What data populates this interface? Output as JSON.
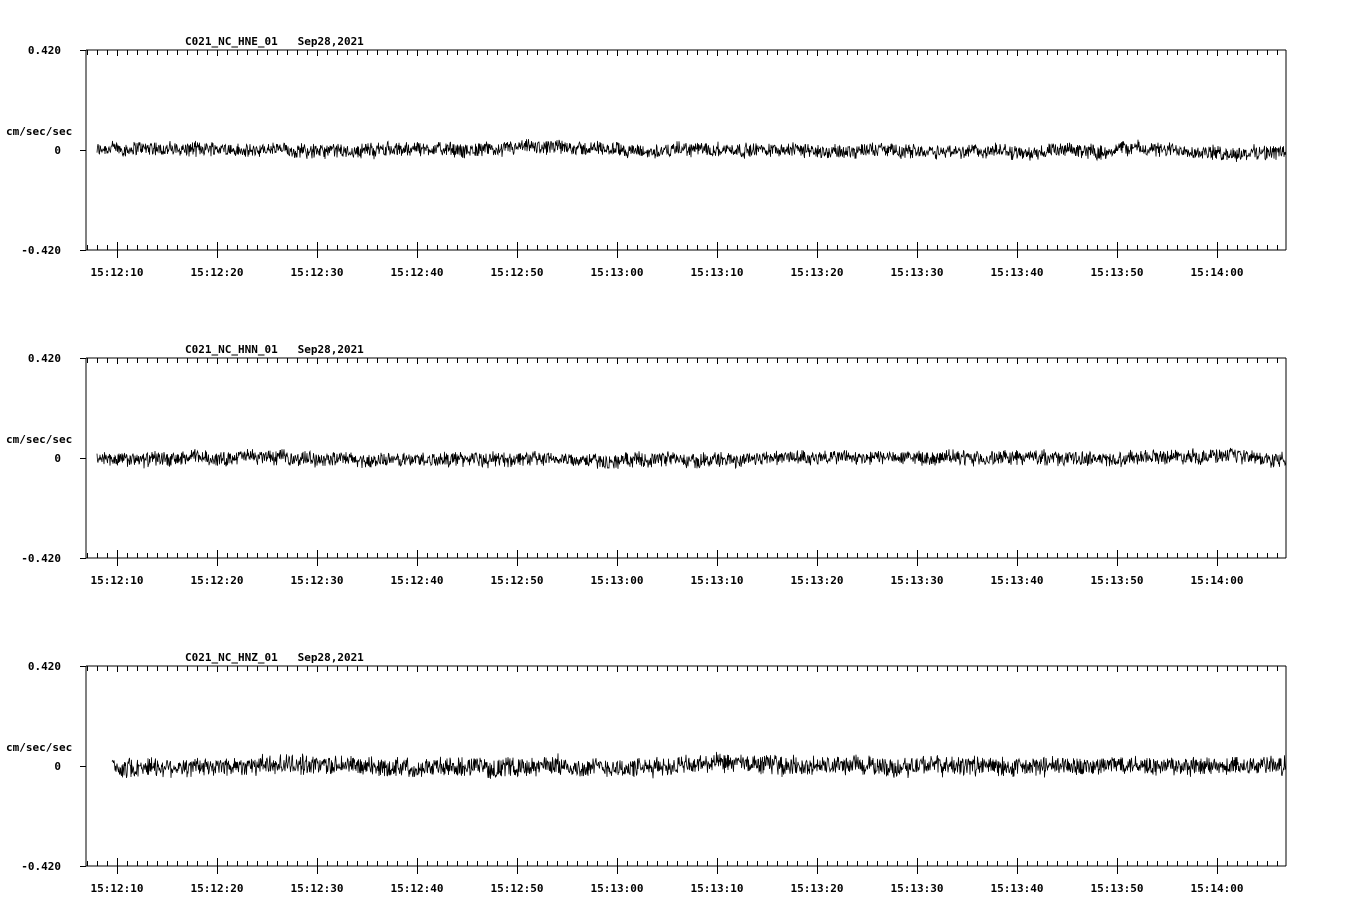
{
  "chart_data": [
    {
      "type": "line",
      "title": "C021_NC_HNE_01   Sep28,2021",
      "ylabel": "cm/sec/sec",
      "ylim": [
        -0.42,
        0.42
      ],
      "yticks": [
        "0.420",
        "0",
        "-0.420"
      ],
      "xticks": [
        "15:12:10",
        "15:12:20",
        "15:12:30",
        "15:12:40",
        "15:12:50",
        "15:13:00",
        "15:13:10",
        "15:13:20",
        "15:13:30",
        "15:13:40",
        "15:13:50",
        "15:14:00"
      ],
      "series": [
        {
          "noise_amplitude": 0.03,
          "start_time": "15:12:08"
        }
      ]
    },
    {
      "type": "line",
      "title": "C021_NC_HNN_01   Sep28,2021",
      "ylabel": "cm/sec/sec",
      "ylim": [
        -0.42,
        0.42
      ],
      "yticks": [
        "0.420",
        "0",
        "-0.420"
      ],
      "xticks": [
        "15:12:10",
        "15:12:20",
        "15:12:30",
        "15:12:40",
        "15:12:50",
        "15:13:00",
        "15:13:10",
        "15:13:20",
        "15:13:30",
        "15:13:40",
        "15:13:50",
        "15:14:00"
      ],
      "series": [
        {
          "noise_amplitude": 0.03,
          "start_time": "15:12:08"
        }
      ]
    },
    {
      "type": "line",
      "title": "C021_NC_HNZ_01   Sep28,2021",
      "ylabel": "cm/sec/sec",
      "ylim": [
        -0.42,
        0.42
      ],
      "yticks": [
        "0.420",
        "0",
        "-0.420"
      ],
      "xticks": [
        "15:12:10",
        "15:12:20",
        "15:12:30",
        "15:12:40",
        "15:12:50",
        "15:13:00",
        "15:13:10",
        "15:13:20",
        "15:13:30",
        "15:13:40",
        "15:13:50",
        "15:14:00"
      ],
      "series": [
        {
          "noise_amplitude": 0.04,
          "start_time": "15:12:09.5"
        }
      ]
    }
  ]
}
